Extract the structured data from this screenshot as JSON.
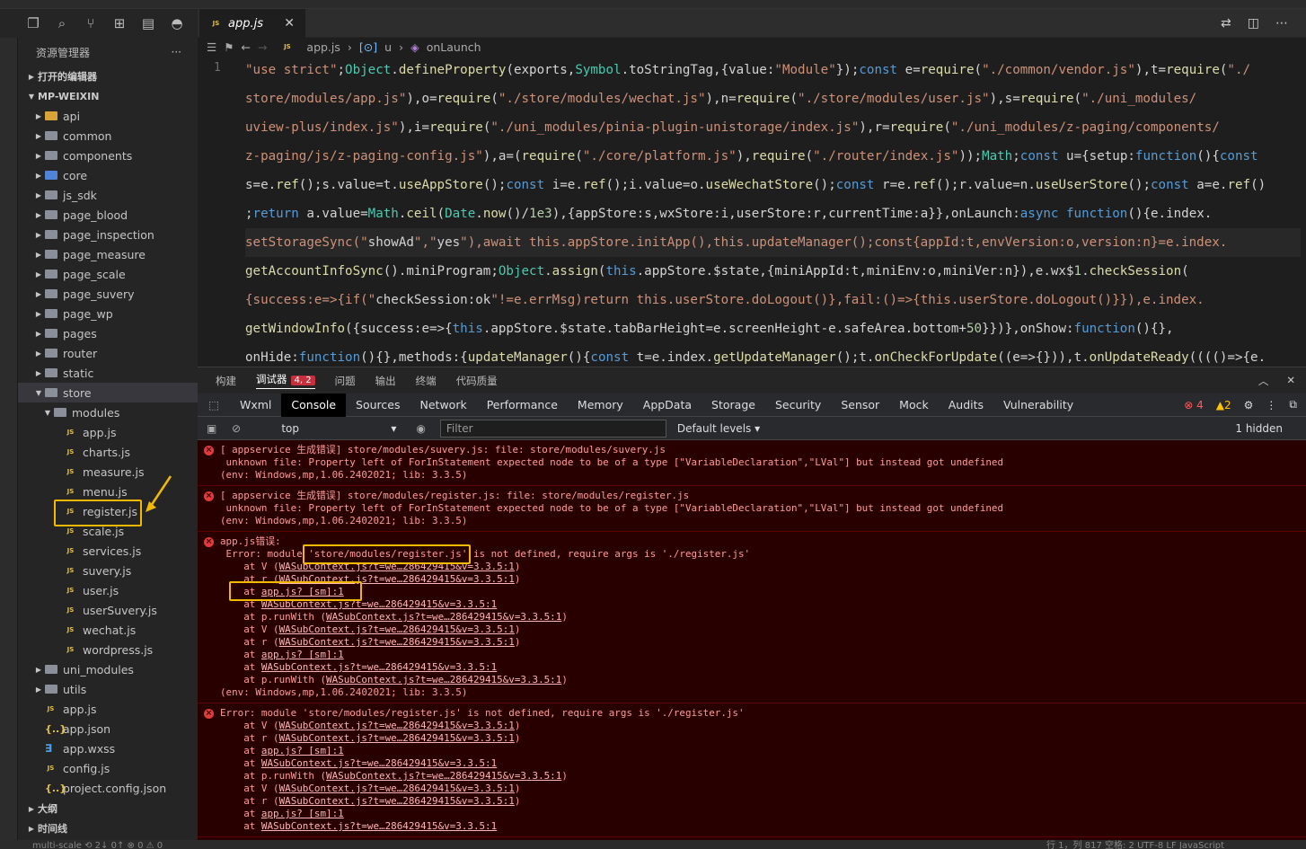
{
  "explorer": {
    "title": "资源管理器",
    "more": "···",
    "sections": {
      "open_editors": "打开的编辑器",
      "project": "MP-WEIXIN",
      "outline": "大纲",
      "timeline": "时间线"
    },
    "folders": [
      "api",
      "common",
      "components",
      "core",
      "js_sdk",
      "page_blood",
      "page_inspection",
      "page_measure",
      "page_scale",
      "page_suvery",
      "page_wp",
      "pages",
      "router",
      "static"
    ],
    "store": "store",
    "modules": "modules",
    "module_files": [
      "app.js",
      "charts.js",
      "measure.js",
      "menu.js",
      "register.js",
      "scale.js",
      "services.js",
      "suvery.js",
      "user.js",
      "userSuvery.js",
      "wechat.js",
      "wordpress.js"
    ],
    "after_folders": [
      "uni_modules",
      "utils"
    ],
    "root_files": [
      "app.js",
      "app.json",
      "app.wxss",
      "config.js",
      "project.config.json"
    ]
  },
  "tab": {
    "label": "app.js",
    "close": "✕"
  },
  "breadcrumb": {
    "file": "app.js",
    "sym1": "u",
    "sym2": "onLaunch"
  },
  "editor": {
    "line_number": "1"
  },
  "panel": {
    "tabs": [
      "构建",
      "调试器",
      "问题",
      "输出",
      "终端",
      "代码质量"
    ],
    "debugger_badge": "4, 2"
  },
  "devtools": {
    "tabs": [
      "Wxml",
      "Console",
      "Sources",
      "Network",
      "Performance",
      "Memory",
      "AppData",
      "Storage",
      "Security",
      "Sensor",
      "Mock",
      "Audits",
      "Vulnerability"
    ],
    "errors": "4",
    "warnings": "2",
    "context": "top",
    "filter_placeholder": "Filter",
    "levels": "Default levels ▾",
    "hidden": "1 hidden"
  },
  "console": {
    "messages": [
      {
        "lines": [
          "[ appservice 生成错误] store/modules/suvery.js: file: store/modules/suvery.js",
          " unknown file: Property left of ForInStatement expected node to be of a type [\"VariableDeclaration\",\"LVal\"] but instead got undefined",
          "(env: Windows,mp,1.06.2402021; lib: 3.3.5)"
        ]
      },
      {
        "lines": [
          "[ appservice 生成错误] store/modules/register.js: file: store/modules/register.js",
          " unknown file: Property left of ForInStatement expected node to be of a type [\"VariableDeclaration\",\"LVal\"] but instead got undefined",
          "(env: Windows,mp,1.06.2402021; lib: 3.3.5)"
        ]
      },
      {
        "lines": [
          "app.js错误:",
          " Error: module 'store/modules/register.js' is not defined, require args is './register.js'",
          "    at V (WASubContext.js?t=we…286429415&v=3.3.5:1)",
          "    at r (WASubContext.js?t=we…286429415&v=3.3.5:1)",
          "    at app.js? [sm]:1",
          "    at WASubContext.js?t=we…286429415&v=3.3.5:1",
          "    at p.runWith (WASubContext.js?t=we…286429415&v=3.3.5:1)",
          "    at V (WASubContext.js?t=we…286429415&v=3.3.5:1)",
          "    at r (WASubContext.js?t=we…286429415&v=3.3.5:1)",
          "    at app.js? [sm]:1",
          "    at WASubContext.js?t=we…286429415&v=3.3.5:1",
          "    at p.runWith (WASubContext.js?t=we…286429415&v=3.3.5:1)",
          "(env: Windows,mp,1.06.2402021; lib: 3.3.5)"
        ]
      },
      {
        "lines": [
          "Error: module 'store/modules/register.js' is not defined, require args is './register.js'",
          "    at V (WASubContext.js?t=we…286429415&v=3.3.5:1)",
          "    at r (WASubContext.js?t=we…286429415&v=3.3.5:1)",
          "    at app.js? [sm]:1",
          "    at WASubContext.js?t=we…286429415&v=3.3.5:1",
          "    at p.runWith (WASubContext.js?t=we…286429415&v=3.3.5:1)",
          "    at V (WASubContext.js?t=we…286429415&v=3.3.5:1)",
          "    at r (WASubContext.js?t=we…286429415&v=3.3.5:1)",
          "    at app.js? [sm]:1",
          "    at WASubContext.js?t=we…286429415&v=3.3.5:1"
        ]
      }
    ]
  },
  "code_lines": [
    "\"use strict\";Object.defineProperty(exports,Symbol.toStringTag,{value:\"Module\"});const e=require(\"./common/vendor.js\"),t=require(\"./",
    "store/modules/app.js\"),o=require(\"./store/modules/wechat.js\"),n=require(\"./store/modules/user.js\"),s=require(\"./uni_modules/",
    "uview-plus/index.js\"),i=require(\"./uni_modules/pinia-plugin-unistorage/index.js\"),r=require(\"./uni_modules/z-paging/components/",
    "z-paging/js/z-paging-config.js\"),a=(require(\"./core/platform.js\"),require(\"./router/index.js\"));Math;const u={setup:function(){const",
    "s=e.ref();s.value=t.useAppStore();const i=e.ref();i.value=o.useWechatStore();const r=e.ref();r.value=n.useUserStore();const a=e.ref()",
    ";return a.value=Math.ceil(Date.now()/1e3),{appStore:s,wxStore:i,userStore:r,currentTime:a}},onLaunch:async function(){e.index.",
    "setStorageSync(\"showAd\",\"yes\"),await this.appStore.initApp(),this.updateManager();const{appId:t,envVersion:o,version:n}=e.index.",
    "getAccountInfoSync().miniProgram;Object.assign(this.appStore.$state,{miniAppId:t,miniEnv:o,miniVer:n}),e.wx$1.checkSession(",
    "{success:e=>{if(\"checkSession:ok\"!=e.errMsg)return this.userStore.doLogout()},fail:()=>{this.userStore.doLogout()}}),e.index.",
    "getWindowInfo({success:e=>{this.appStore.$state.tabBarHeight=e.screenHeight-e.safeArea.bottom+50}})},onShow:function(){},",
    "onHide:function(){},methods:{updateManager(){const t=e.index.getUpdateManager();t.onCheckForUpdate((e=>{})),t.onUpdateReady(((()=>{e."
  ],
  "status": {
    "left": "multi-scale   ⟲ 2↓ 0↑   ⊗ 0 ⚠ 0",
    "right": "行 1，列 817   空格: 2   UTF-8   LF   JavaScript"
  }
}
